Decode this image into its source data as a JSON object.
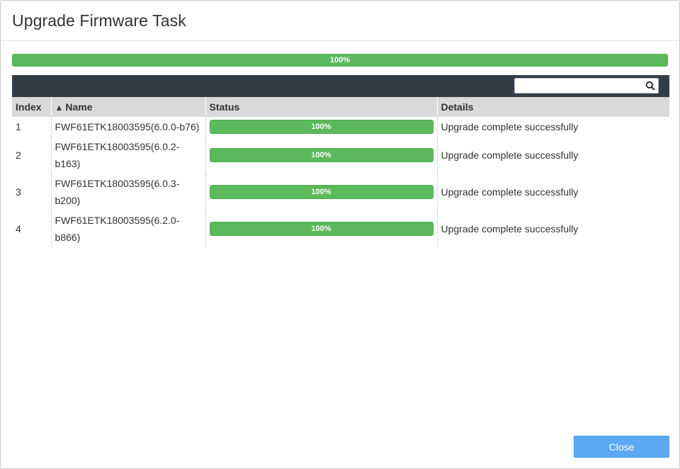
{
  "dialog": {
    "title": "Upgrade Firmware Task"
  },
  "overall_progress": {
    "value_percent": 100,
    "label": "100%",
    "color": "#5cb85c"
  },
  "search": {
    "value": "",
    "placeholder": "",
    "icon": "search-icon"
  },
  "table": {
    "columns": [
      {
        "label": "Index"
      },
      {
        "label": "Name",
        "sort_icon": "▲",
        "sort": "ascending"
      },
      {
        "label": "Status"
      },
      {
        "label": "Details"
      }
    ],
    "rows": [
      {
        "index": "1",
        "name": "FWF61ETK18003595(6.0.0-b76)",
        "status_label": "100%",
        "status_percent": 100,
        "details": "Upgrade complete successfully"
      },
      {
        "index": "2",
        "name": "FWF61ETK18003595(6.0.2-b163)",
        "status_label": "100%",
        "status_percent": 100,
        "details": "Upgrade complete successfully"
      },
      {
        "index": "3",
        "name": "FWF61ETK18003595(6.0.3-b200)",
        "status_label": "100%",
        "status_percent": 100,
        "details": "Upgrade complete successfully"
      },
      {
        "index": "4",
        "name": "FWF61ETK18003595(6.2.0-b866)",
        "status_label": "100%",
        "status_percent": 100,
        "details": "Upgrade complete successfully"
      }
    ]
  },
  "footer": {
    "close_label": "Close"
  },
  "colors": {
    "progress_green": "#5cb85c",
    "toolbar_dark": "#343d47",
    "header_gray": "#d9d9d9",
    "button_blue": "#5aa9f2"
  }
}
